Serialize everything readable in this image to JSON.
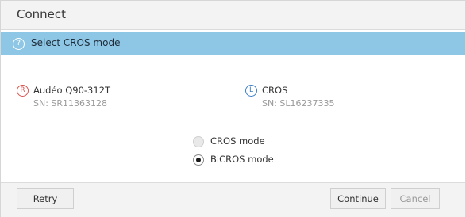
{
  "dialog": {
    "title": "Connect"
  },
  "banner": {
    "icon": "help-icon",
    "icon_glyph": "?",
    "text": "Select CROS mode",
    "color": "#8ec6e6"
  },
  "devices": {
    "right": {
      "side_badge": "R",
      "name": "Audéo Q90-312T",
      "serial": "SN: SR11363128"
    },
    "left": {
      "side_badge": "L",
      "name": "CROS",
      "serial": "SN: SL16237335"
    }
  },
  "modes": {
    "selected": "BiCROS mode",
    "options": [
      {
        "label": "CROS mode",
        "checked": false
      },
      {
        "label": "BiCROS mode",
        "checked": true
      }
    ]
  },
  "footer": {
    "retry_label": "Retry",
    "continue_label": "Continue",
    "cancel_label": "Cancel"
  },
  "colors": {
    "right_side": "#d9534f",
    "left_side": "#3b7fc4"
  }
}
